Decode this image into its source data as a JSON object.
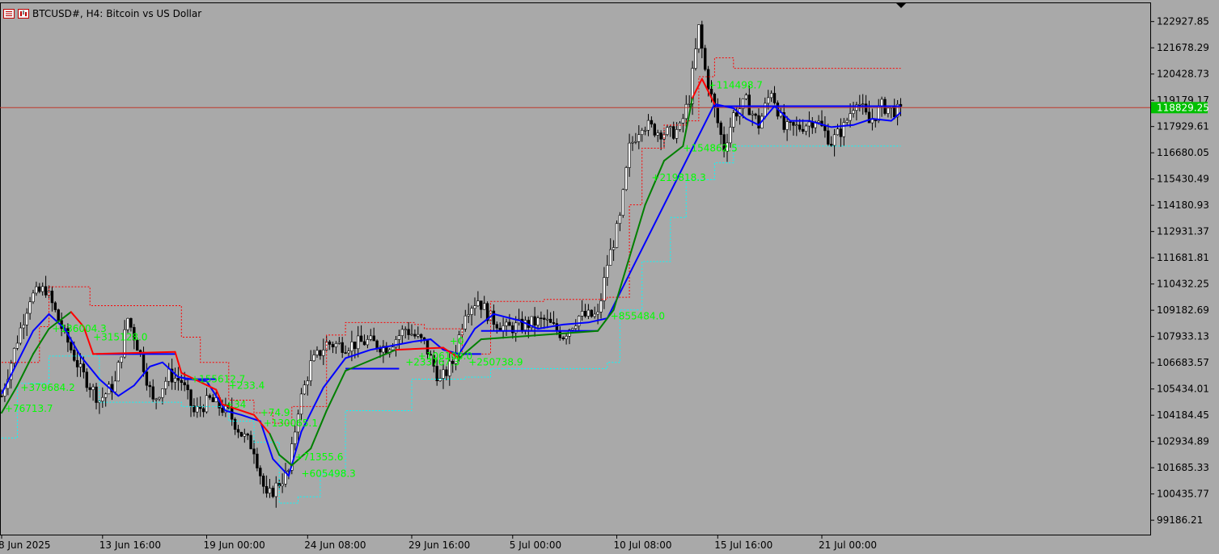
{
  "header": {
    "symbol": "BTCUSD#, H4:",
    "description": "Bitcoin vs US Dollar"
  },
  "colors": {
    "background": "#a9a9a9",
    "candle": "#000000",
    "trend_up": "#008000",
    "trend_down": "#ff0000",
    "mid_line": "#0000ff",
    "upper_band": "#ff0000",
    "lower_band": "#00ffff",
    "label_text": "#00ff00",
    "price_line": "#c0392b",
    "price_tag": "#00c000"
  },
  "chart_data": {
    "type": "candlestick",
    "symbol": "BTCUSD#",
    "timeframe": "H4",
    "ylim": [
      98500,
      123800
    ],
    "y_ticks": [
      "122927.85",
      "121678.29",
      "120428.73",
      "119179.17",
      "117929.61",
      "116680.05",
      "115430.49",
      "114180.93",
      "112931.37",
      "111681.81",
      "110432.25",
      "109182.69",
      "107933.13",
      "106683.57",
      "105434.01",
      "104184.45",
      "102934.89",
      "101685.33",
      "100435.77",
      "99186.21"
    ],
    "x_ticks": [
      "8 Jun 2025",
      "13 Jun 16:00",
      "19 Jun 00:00",
      "24 Jun 08:00",
      "29 Jun 16:00",
      "5 Jul 00:00",
      "10 Jul 08:00",
      "15 Jul 16:00",
      "21 Jul 00:00"
    ],
    "current_price": "118829.25",
    "price_path": [
      {
        "bar": 0,
        "price": 105100
      },
      {
        "bar": 5,
        "price": 107800
      },
      {
        "bar": 9,
        "price": 109800
      },
      {
        "bar": 14,
        "price": 110200
      },
      {
        "bar": 20,
        "price": 108000
      },
      {
        "bar": 25,
        "price": 106300
      },
      {
        "bar": 31,
        "price": 104900
      },
      {
        "bar": 36,
        "price": 105700
      },
      {
        "bar": 40,
        "price": 108800
      },
      {
        "bar": 44,
        "price": 107100
      },
      {
        "bar": 48,
        "price": 104800
      },
      {
        "bar": 53,
        "price": 106100
      },
      {
        "bar": 57,
        "price": 105800
      },
      {
        "bar": 61,
        "price": 104300
      },
      {
        "bar": 66,
        "price": 104900
      },
      {
        "bar": 72,
        "price": 104300
      },
      {
        "bar": 76,
        "price": 103300
      },
      {
        "bar": 80,
        "price": 102600
      },
      {
        "bar": 84,
        "price": 100200
      },
      {
        "bar": 87,
        "price": 100800
      },
      {
        "bar": 91,
        "price": 101500
      },
      {
        "bar": 94,
        "price": 104500
      },
      {
        "bar": 98,
        "price": 106600
      },
      {
        "bar": 103,
        "price": 107600
      },
      {
        "bar": 109,
        "price": 107500
      },
      {
        "bar": 116,
        "price": 107700
      },
      {
        "bar": 122,
        "price": 107400
      },
      {
        "bar": 128,
        "price": 108300
      },
      {
        "bar": 134,
        "price": 107600
      },
      {
        "bar": 139,
        "price": 105800
      },
      {
        "bar": 143,
        "price": 106700
      },
      {
        "bar": 147,
        "price": 109200
      },
      {
        "bar": 151,
        "price": 109700
      },
      {
        "bar": 155,
        "price": 108800
      },
      {
        "bar": 160,
        "price": 108300
      },
      {
        "bar": 166,
        "price": 108500
      },
      {
        "bar": 172,
        "price": 108700
      },
      {
        "bar": 178,
        "price": 108000
      },
      {
        "bar": 183,
        "price": 108900
      },
      {
        "bar": 189,
        "price": 108900
      },
      {
        "bar": 192,
        "price": 111400
      },
      {
        "bar": 196,
        "price": 113500
      },
      {
        "bar": 199,
        "price": 116900
      },
      {
        "bar": 203,
        "price": 118100
      },
      {
        "bar": 208,
        "price": 117700
      },
      {
        "bar": 212,
        "price": 117600
      },
      {
        "bar": 215,
        "price": 117800
      },
      {
        "bar": 218,
        "price": 119300
      },
      {
        "bar": 221,
        "price": 122600
      },
      {
        "bar": 223,
        "price": 120600
      },
      {
        "bar": 226,
        "price": 118700
      },
      {
        "bar": 229,
        "price": 116900
      },
      {
        "bar": 232,
        "price": 118500
      },
      {
        "bar": 236,
        "price": 119100
      },
      {
        "bar": 240,
        "price": 118000
      },
      {
        "bar": 244,
        "price": 119700
      },
      {
        "bar": 248,
        "price": 117800
      },
      {
        "bar": 253,
        "price": 117900
      },
      {
        "bar": 258,
        "price": 118300
      },
      {
        "bar": 263,
        "price": 117200
      },
      {
        "bar": 267,
        "price": 117900
      },
      {
        "bar": 271,
        "price": 119300
      },
      {
        "bar": 275,
        "price": 118100
      },
      {
        "bar": 279,
        "price": 118900
      },
      {
        "bar": 285,
        "price": 118600
      }
    ],
    "upper_band": [
      {
        "bar": 0,
        "price": 106700
      },
      {
        "bar": 12,
        "price": 108400
      },
      {
        "bar": 15,
        "price": 110300
      },
      {
        "bar": 28,
        "price": 109400
      },
      {
        "bar": 57,
        "price": 107900
      },
      {
        "bar": 63,
        "price": 106700
      },
      {
        "bar": 72,
        "price": 104900
      },
      {
        "bar": 80,
        "price": 104300
      },
      {
        "bar": 86,
        "price": 103800
      },
      {
        "bar": 92,
        "price": 104600
      },
      {
        "bar": 103,
        "price": 108000
      },
      {
        "bar": 109,
        "price": 108600
      },
      {
        "bar": 131,
        "price": 108500
      },
      {
        "bar": 134,
        "price": 108300
      },
      {
        "bar": 146,
        "price": 107100
      },
      {
        "bar": 155,
        "price": 109600
      },
      {
        "bar": 172,
        "price": 109700
      },
      {
        "bar": 192,
        "price": 109800
      },
      {
        "bar": 199,
        "price": 114200
      },
      {
        "bar": 203,
        "price": 116900
      },
      {
        "bar": 210,
        "price": 118000
      },
      {
        "bar": 217,
        "price": 118200
      },
      {
        "bar": 221,
        "price": 120300
      },
      {
        "bar": 226,
        "price": 121200
      },
      {
        "bar": 232,
        "price": 120700
      },
      {
        "bar": 285,
        "price": 120700
      }
    ],
    "lower_band": [
      {
        "bar": 0,
        "price": 103100
      },
      {
        "bar": 5,
        "price": 105700
      },
      {
        "bar": 15,
        "price": 107000
      },
      {
        "bar": 31,
        "price": 104800
      },
      {
        "bar": 53,
        "price": 104800
      },
      {
        "bar": 57,
        "price": 104600
      },
      {
        "bar": 72,
        "price": 103900
      },
      {
        "bar": 80,
        "price": 102900
      },
      {
        "bar": 88,
        "price": 100000
      },
      {
        "bar": 94,
        "price": 100300
      },
      {
        "bar": 101,
        "price": 101400
      },
      {
        "bar": 109,
        "price": 104400
      },
      {
        "bar": 126,
        "price": 104400
      },
      {
        "bar": 130,
        "price": 105900
      },
      {
        "bar": 147,
        "price": 106000
      },
      {
        "bar": 155,
        "price": 106400
      },
      {
        "bar": 192,
        "price": 106700
      },
      {
        "bar": 196,
        "price": 109200
      },
      {
        "bar": 203,
        "price": 111500
      },
      {
        "bar": 212,
        "price": 113600
      },
      {
        "bar": 217,
        "price": 115400
      },
      {
        "bar": 226,
        "price": 116200
      },
      {
        "bar": 232,
        "price": 117000
      },
      {
        "bar": 285,
        "price": 117000
      }
    ],
    "trend_line": [
      {
        "bar": 0,
        "price": 104300,
        "dir": "up"
      },
      {
        "bar": 5,
        "price": 105600,
        "dir": "up"
      },
      {
        "bar": 10,
        "price": 107100,
        "dir": "up"
      },
      {
        "bar": 15,
        "price": 108300,
        "dir": "up"
      },
      {
        "bar": 22,
        "price": 109100,
        "dir": "up"
      },
      {
        "bar": 26,
        "price": 108400,
        "dir": "down"
      },
      {
        "bar": 29,
        "price": 107100,
        "dir": "down"
      },
      {
        "bar": 55,
        "price": 107200,
        "dir": "down"
      },
      {
        "bar": 57,
        "price": 106200,
        "dir": "down"
      },
      {
        "bar": 68,
        "price": 105400,
        "dir": "down"
      },
      {
        "bar": 70,
        "price": 104700,
        "dir": "down"
      },
      {
        "bar": 80,
        "price": 104200,
        "dir": "down"
      },
      {
        "bar": 85,
        "price": 103300,
        "dir": "down"
      },
      {
        "bar": 88,
        "price": 102300,
        "dir": "up"
      },
      {
        "bar": 92,
        "price": 101800,
        "dir": "up"
      },
      {
        "bar": 98,
        "price": 102600,
        "dir": "up"
      },
      {
        "bar": 103,
        "price": 104400,
        "dir": "up"
      },
      {
        "bar": 109,
        "price": 106300,
        "dir": "up"
      },
      {
        "bar": 125,
        "price": 107300,
        "dir": "up"
      },
      {
        "bar": 140,
        "price": 107400,
        "dir": "down"
      },
      {
        "bar": 145,
        "price": 106900,
        "dir": "down"
      },
      {
        "bar": 152,
        "price": 107800,
        "dir": "up"
      },
      {
        "bar": 189,
        "price": 108200,
        "dir": "up"
      },
      {
        "bar": 194,
        "price": 109200,
        "dir": "up"
      },
      {
        "bar": 200,
        "price": 112200,
        "dir": "up"
      },
      {
        "bar": 204,
        "price": 114200,
        "dir": "up"
      },
      {
        "bar": 210,
        "price": 116300,
        "dir": "up"
      },
      {
        "bar": 216,
        "price": 117000,
        "dir": "up"
      },
      {
        "bar": 219,
        "price": 119300,
        "dir": "up"
      },
      {
        "bar": 222,
        "price": 120200,
        "dir": "down"
      },
      {
        "bar": 226,
        "price": 119000,
        "dir": "down"
      }
    ],
    "mid_line": [
      {
        "bar": 0,
        "price": 105200
      },
      {
        "bar": 10,
        "price": 108200
      },
      {
        "bar": 15,
        "price": 109000
      },
      {
        "bar": 20,
        "price": 108300
      },
      {
        "bar": 25,
        "price": 107000
      },
      {
        "bar": 31,
        "price": 105900
      },
      {
        "bar": 37,
        "price": 105100
      },
      {
        "bar": 42,
        "price": 105600
      },
      {
        "bar": 47,
        "price": 106500
      },
      {
        "bar": 51,
        "price": 106700
      },
      {
        "bar": 56,
        "price": 106000
      },
      {
        "bar": 60,
        "price": 105900
      },
      {
        "bar": 65,
        "price": 105800
      },
      {
        "bar": 71,
        "price": 104400
      },
      {
        "bar": 76,
        "price": 104200
      },
      {
        "bar": 82,
        "price": 103900
      },
      {
        "bar": 86,
        "price": 102100
      },
      {
        "bar": 91,
        "price": 101300
      },
      {
        "bar": 95,
        "price": 103400
      },
      {
        "bar": 102,
        "price": 105500
      },
      {
        "bar": 109,
        "price": 106900
      },
      {
        "bar": 117,
        "price": 107300
      },
      {
        "bar": 124,
        "price": 107500
      },
      {
        "bar": 131,
        "price": 107700
      },
      {
        "bar": 136,
        "price": 107800
      },
      {
        "bar": 140,
        "price": 107300
      },
      {
        "bar": 145,
        "price": 107100
      },
      {
        "bar": 150,
        "price": 108300
      },
      {
        "bar": 156,
        "price": 109000
      },
      {
        "bar": 164,
        "price": 108700
      },
      {
        "bar": 170,
        "price": 108300
      },
      {
        "bar": 178,
        "price": 108500
      },
      {
        "bar": 186,
        "price": 108600
      },
      {
        "bar": 192,
        "price": 108800
      },
      {
        "bar": 226,
        "price": 119000
      },
      {
        "bar": 232,
        "price": 118800
      },
      {
        "bar": 236,
        "price": 118300
      },
      {
        "bar": 240,
        "price": 118000
      },
      {
        "bar": 245,
        "price": 118900
      },
      {
        "bar": 250,
        "price": 118200
      },
      {
        "bar": 256,
        "price": 118200
      },
      {
        "bar": 263,
        "price": 117900
      },
      {
        "bar": 270,
        "price": 118000
      },
      {
        "bar": 276,
        "price": 118300
      },
      {
        "bar": 282,
        "price": 118200
      },
      {
        "bar": 285,
        "price": 118600
      }
    ],
    "support_steps": [
      {
        "from_bar": 30,
        "to_bar": 55,
        "price": 107100
      },
      {
        "from_bar": 58,
        "to_bar": 68,
        "price": 105900
      },
      {
        "from_bar": 109,
        "to_bar": 126,
        "price": 106400
      },
      {
        "from_bar": 146,
        "to_bar": 152,
        "price": 107100
      },
      {
        "from_bar": 152,
        "to_bar": 189,
        "price": 108200
      },
      {
        "from_bar": 226,
        "to_bar": 285,
        "price": 118900
      }
    ],
    "annotations": [
      {
        "text": "+136004.3",
        "bar": 16,
        "price": 108300
      },
      {
        "text": "+315128.0",
        "bar": 29,
        "price": 107900
      },
      {
        "text": "+379684.2",
        "bar": 6,
        "price": 105500
      },
      {
        "text": "+76713.7",
        "bar": 1,
        "price": 104500
      },
      {
        "text": "+155612.7",
        "bar": 60,
        "price": 105900
      },
      {
        "text": "+233.4",
        "bar": 72,
        "price": 105600
      },
      {
        "text": "+34",
        "bar": 71,
        "price": 104700
      },
      {
        "text": "+74.9",
        "bar": 82,
        "price": 104300
      },
      {
        "text": "+130065.1",
        "bar": 83,
        "price": 103800
      },
      {
        "text": "+71355.6",
        "bar": 93,
        "price": 102200
      },
      {
        "text": "+605498.3",
        "bar": 95,
        "price": 101400
      },
      {
        "text": "+106100.0",
        "bar": 132,
        "price": 107000
      },
      {
        "text": "+233767.3",
        "bar": 128,
        "price": 106700
      },
      {
        "text": "+0",
        "bar": 142,
        "price": 107700
      },
      {
        "text": "+250738.9",
        "bar": 148,
        "price": 106700
      },
      {
        "text": "+855484.0",
        "bar": 193,
        "price": 108900
      },
      {
        "text": "+219818.3",
        "bar": 206,
        "price": 115500
      },
      {
        "text": "+154862.5",
        "bar": 216,
        "price": 116900
      },
      {
        "text": "+114498.7",
        "bar": 224,
        "price": 119900
      }
    ]
  }
}
